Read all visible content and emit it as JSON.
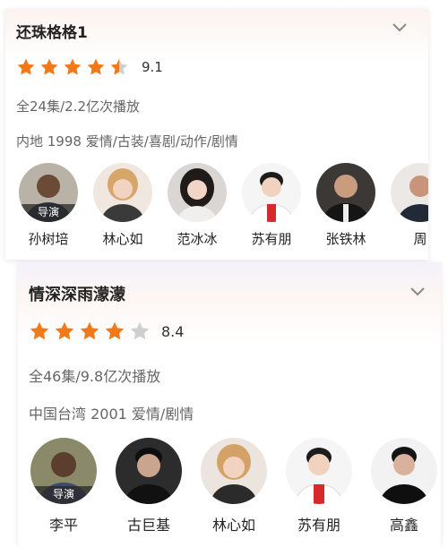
{
  "colors": {
    "star_on": "#f07a1a",
    "star_off": "#cfcfcf"
  },
  "cards": [
    {
      "title": "还珠格格1",
      "rating": 9.1,
      "rating_text": "9.1",
      "stars_filled": 4.5,
      "meta_episodes": "全24集/2.2亿次播放",
      "meta_info": "内地 1998 爱情/古装/喜剧/动作/剧情",
      "expand_icon": "chevron-down-icon",
      "cast": [
        {
          "name": "孙树培",
          "role": "导演"
        },
        {
          "name": "林心如",
          "role": ""
        },
        {
          "name": "范冰冰",
          "role": ""
        },
        {
          "name": "苏有朋",
          "role": ""
        },
        {
          "name": "张铁林",
          "role": ""
        },
        {
          "name": "周",
          "role": ""
        }
      ]
    },
    {
      "title": "情深深雨濛濛",
      "rating": 8.4,
      "rating_text": "8.4",
      "stars_filled": 4,
      "meta_episodes": "全46集/9.8亿次播放",
      "meta_info": "中国台湾 2001 爱情/剧情",
      "expand_icon": "chevron-down-icon",
      "cast": [
        {
          "name": "李平",
          "role": "导演"
        },
        {
          "name": "古巨基",
          "role": ""
        },
        {
          "name": "林心如",
          "role": ""
        },
        {
          "name": "苏有朋",
          "role": ""
        },
        {
          "name": "高鑫",
          "role": ""
        }
      ]
    }
  ]
}
